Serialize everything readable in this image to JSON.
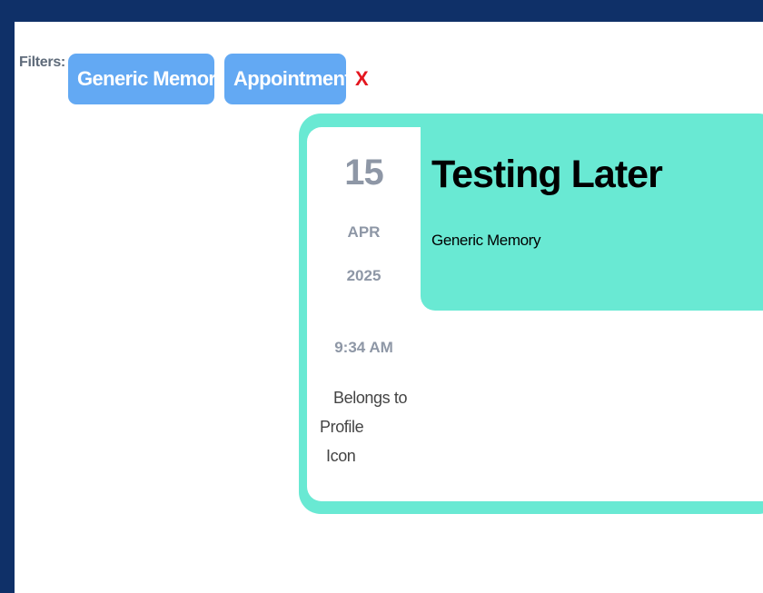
{
  "filters": {
    "label": "Filters:",
    "chips": [
      {
        "label": "Generic Memory",
        "remove": "X"
      },
      {
        "label": "Appointment",
        "remove": "X"
      }
    ]
  },
  "card": {
    "title": "Testing Later",
    "category": "Generic Memory",
    "date": {
      "day": "15",
      "month": "APR",
      "year": "2025",
      "time": "9:34 AM"
    },
    "owner": {
      "line1": "Belongs to",
      "line2": "Profile",
      "line3": "Icon"
    }
  },
  "colors": {
    "background": "#0f3068",
    "chip": "#63a9f3",
    "remove": "#e4161f",
    "card_accent": "#69e9d3",
    "date_text": "#8e97a6"
  }
}
